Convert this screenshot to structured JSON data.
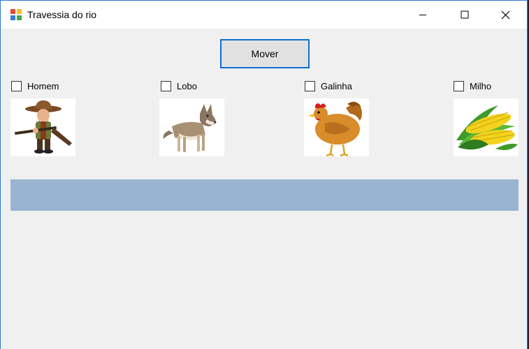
{
  "window": {
    "title": "Travessia do rio"
  },
  "controls": {
    "move_label": "Mover"
  },
  "items": [
    {
      "label": "Homem",
      "checked": false,
      "icon": "hunter-image"
    },
    {
      "label": "Lobo",
      "checked": false,
      "icon": "wolf-image"
    },
    {
      "label": "Galinha",
      "checked": false,
      "icon": "chicken-image"
    },
    {
      "label": "Milho",
      "checked": false,
      "icon": "corn-image"
    }
  ],
  "colors": {
    "river": "#99b4d1",
    "accent": "#0f6fd0",
    "background": "#f0f0f0"
  }
}
